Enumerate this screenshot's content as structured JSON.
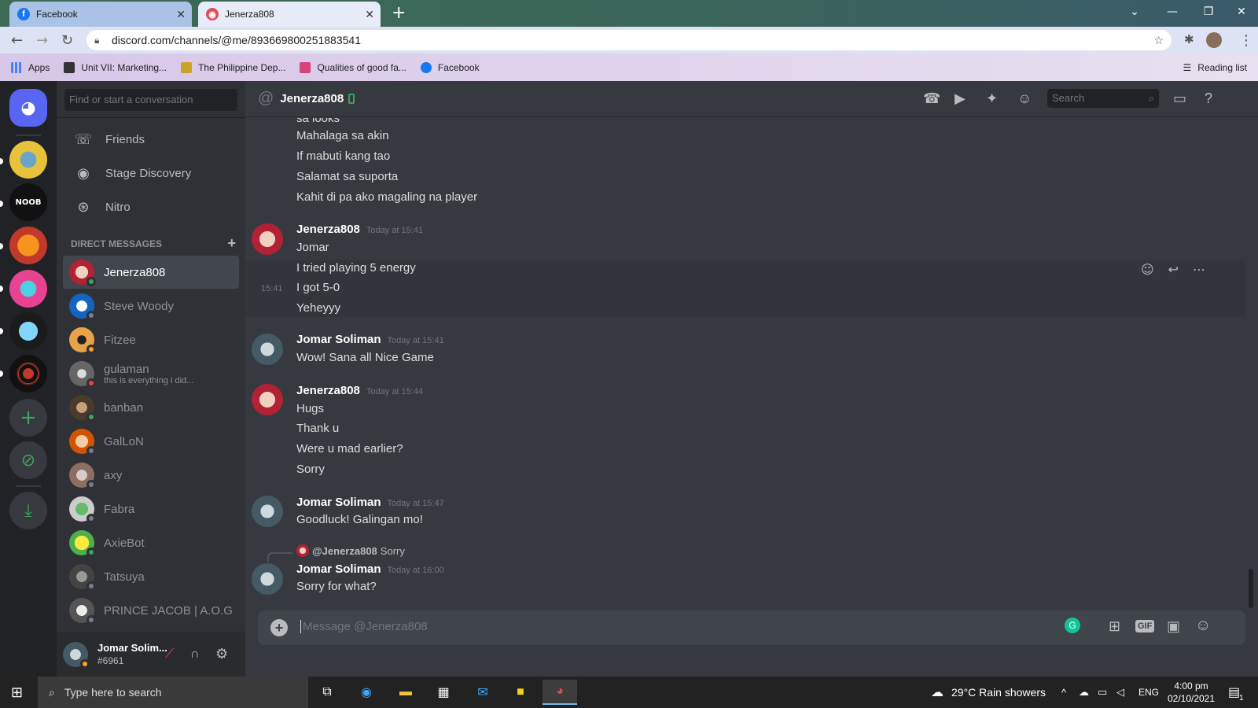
{
  "browser": {
    "tabs": [
      {
        "label": "Facebook"
      },
      {
        "label": "Jenerza808"
      }
    ],
    "url": "discord.com/channels/@me/893669800251883541",
    "bookmarks": [
      "Apps",
      "Unit VII: Marketing...",
      "The Philippine Dep...",
      "Qualities of good fa...",
      "Facebook"
    ],
    "reading_list": "Reading list"
  },
  "sidebar": {
    "search_placeholder": "Find or start a conversation",
    "nav": [
      "Friends",
      "Stage Discovery",
      "Nitro"
    ],
    "dm_header": "DIRECT MESSAGES",
    "dms": [
      {
        "name": "Jenerza808",
        "status": "#3ba55d"
      },
      {
        "name": "Steve Woody",
        "status": "#747f8d"
      },
      {
        "name": "Fitzee",
        "status": "#faa61a"
      },
      {
        "name": "gulaman",
        "status": "#ed4245",
        "sub": "this is everything i did..."
      },
      {
        "name": "banban",
        "status": "#3ba55d"
      },
      {
        "name": "GalLoN",
        "status": "#747f8d"
      },
      {
        "name": "axy",
        "status": "#747f8d"
      },
      {
        "name": "Fabra",
        "status": "#747f8d"
      },
      {
        "name": "AxieBot",
        "status": "#3ba55d"
      },
      {
        "name": "Tatsuya",
        "status": "#747f8d"
      },
      {
        "name": "PRINCE JACOB | A.O.G",
        "status": "#747f8d"
      }
    ]
  },
  "user": {
    "name": "Jomar Solim...",
    "tag": "#6961"
  },
  "chat": {
    "title": "Jenerza808",
    "search": "Search",
    "input_placeholder": "Message @Jenerza808",
    "gif": "GIF",
    "messages": {
      "a1": "sa looks",
      "a2": "Mahalaga sa akin",
      "a3": "If mabuti kang tao",
      "a4": "Salamat sa suporta",
      "a5": "Kahit di pa ako magaling na player",
      "g1_name": "Jenerza808",
      "g1_time": "Today at 15:41",
      "g1_l1": "Jomar",
      "g1_l2": "I tried playing 5 energy",
      "g1_hover_time": "15:41",
      "g1_l3": "I got 5-0",
      "g1_l4": "Yeheyyy",
      "g2_name": "Jomar Soliman",
      "g2_time": "Today at 15:41",
      "g2_l1": "Wow! Sana all Nice Game",
      "g3_name": "Jenerza808",
      "g3_time": "Today at 15:44",
      "g3_l1": "Hugs",
      "g3_l2": "Thank u",
      "g3_l3": "Were u mad earlier?",
      "g3_l4": "Sorry",
      "g4_name": "Jomar Soliman",
      "g4_time": "Today at 15:47",
      "g4_l1": "Goodluck! Galingan mo!",
      "g5_reply_name": "@Jenerza808",
      "g5_reply_text": "Sorry",
      "g5_name": "Jomar Soliman",
      "g5_time": "Today at 16:00",
      "g5_l1": "Sorry for what?"
    }
  },
  "taskbar": {
    "search": "Type here to search",
    "weather": "29°C  Rain showers",
    "lang": "ENG",
    "time": "4:00 pm",
    "date": "02/10/2021",
    "notif": "1"
  }
}
